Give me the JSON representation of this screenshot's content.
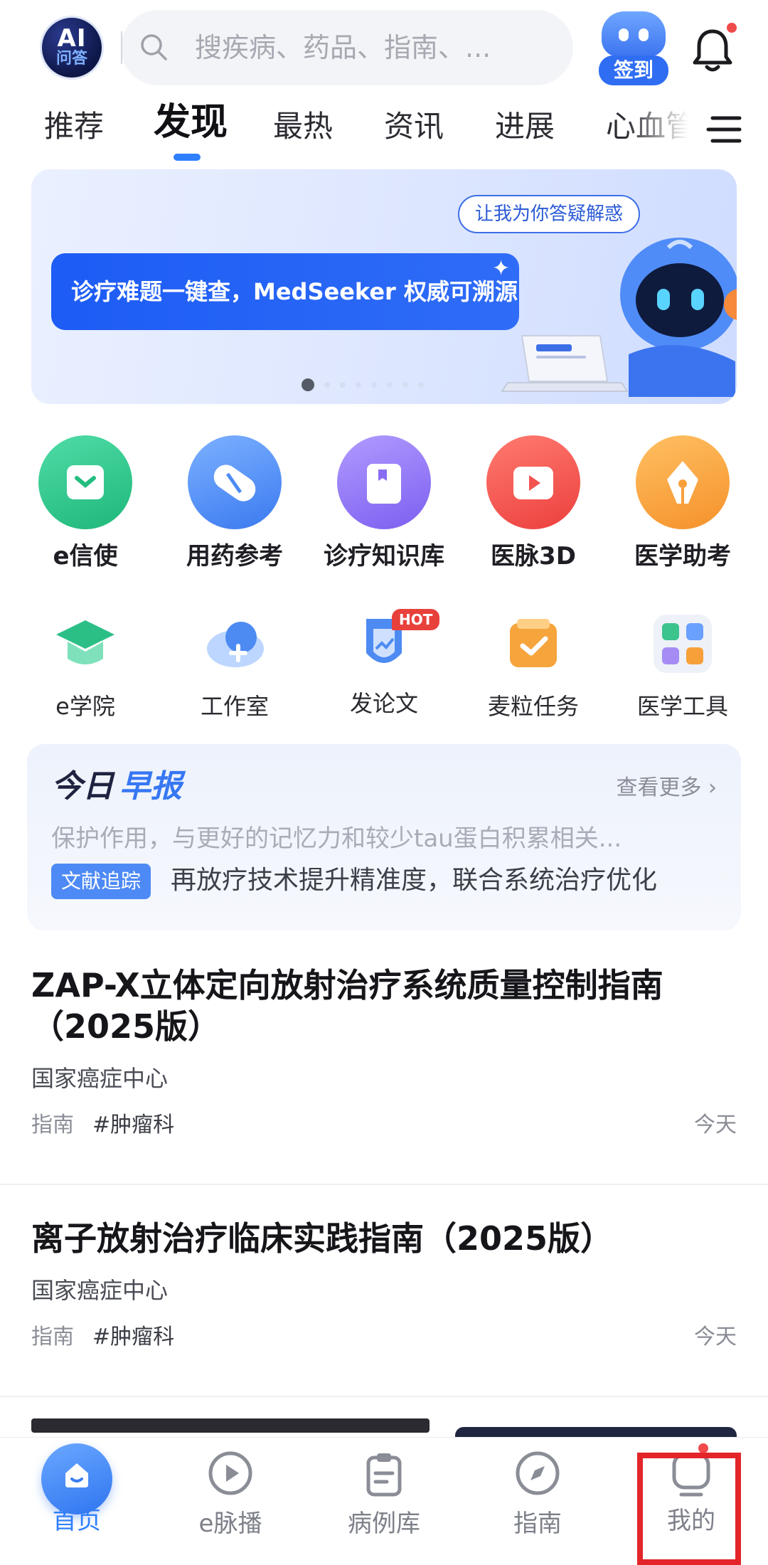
{
  "header": {
    "logo_text_top": "AI",
    "logo_text_bottom": "问答",
    "search_placeholder": "搜疾病、药品、指南、...",
    "signin_label": "签到"
  },
  "tabs": [
    {
      "label": "推荐"
    },
    {
      "label": "发现",
      "active": true
    },
    {
      "label": "最热"
    },
    {
      "label": "资讯"
    },
    {
      "label": "进展"
    },
    {
      "label": "心血管"
    }
  ],
  "banner": {
    "bubble_text": "让我为你答疑解惑",
    "headline": "诊疗难题一键查，MedSeeker 权威可溯源",
    "brand": "MedSeeker",
    "active_slide": 1,
    "slide_count": 8
  },
  "shortcuts_primary": [
    {
      "label": "e信使",
      "icon": "chat-icon",
      "color": "#2cc58a"
    },
    {
      "label": "用药参考",
      "icon": "pill-icon",
      "color": "#4d8bf3"
    },
    {
      "label": "诊疗知识库",
      "icon": "book-icon",
      "color": "#8b6df2"
    },
    {
      "label": "医脉3D",
      "icon": "play-icon",
      "color": "#f2534f"
    },
    {
      "label": "医学助考",
      "icon": "pen-icon",
      "color": "#f7a03a"
    }
  ],
  "shortcuts_secondary": [
    {
      "label": "e学院",
      "icon": "graduation-cap-icon"
    },
    {
      "label": "工作室",
      "icon": "cloud-plus-icon"
    },
    {
      "label": "发论文",
      "icon": "paper-shield-icon",
      "badge": "HOT"
    },
    {
      "label": "麦粒任务",
      "icon": "task-check-icon"
    },
    {
      "label": "医学工具",
      "icon": "tools-grid-icon"
    }
  ],
  "daily": {
    "title_a": "今日",
    "title_b": "早报",
    "more": "查看更多 ›",
    "line1": "保护作用，与更好的记忆力和较少tau蛋白积累相关...",
    "tag": "文献追踪",
    "line2": "再放疗技术提升精准度，联合系统治疗优化"
  },
  "articles": [
    {
      "title": "ZAP-X立体定向放射治疗系统质量控制指南（2025版）",
      "source": "国家癌症中心",
      "type": "指南",
      "topic": "#肿瘤科",
      "date": "今天"
    },
    {
      "title": "离子放射治疗临床实践指南（2025版）",
      "source": "国家癌症中心",
      "type": "指南",
      "topic": "#肿瘤科",
      "date": "今天"
    }
  ],
  "bottom_nav": [
    {
      "label": "首页",
      "icon": "home-icon",
      "active": true
    },
    {
      "label": "e脉播",
      "icon": "play-circle-icon"
    },
    {
      "label": "病例库",
      "icon": "clipboard-icon"
    },
    {
      "label": "指南",
      "icon": "compass-icon"
    },
    {
      "label": "我的",
      "icon": "profile-icon",
      "has_dot": true
    }
  ],
  "colors": {
    "accent": "#2f80ff",
    "highlight_box": "#e3252a",
    "notification_dot": "#f04a4a"
  }
}
